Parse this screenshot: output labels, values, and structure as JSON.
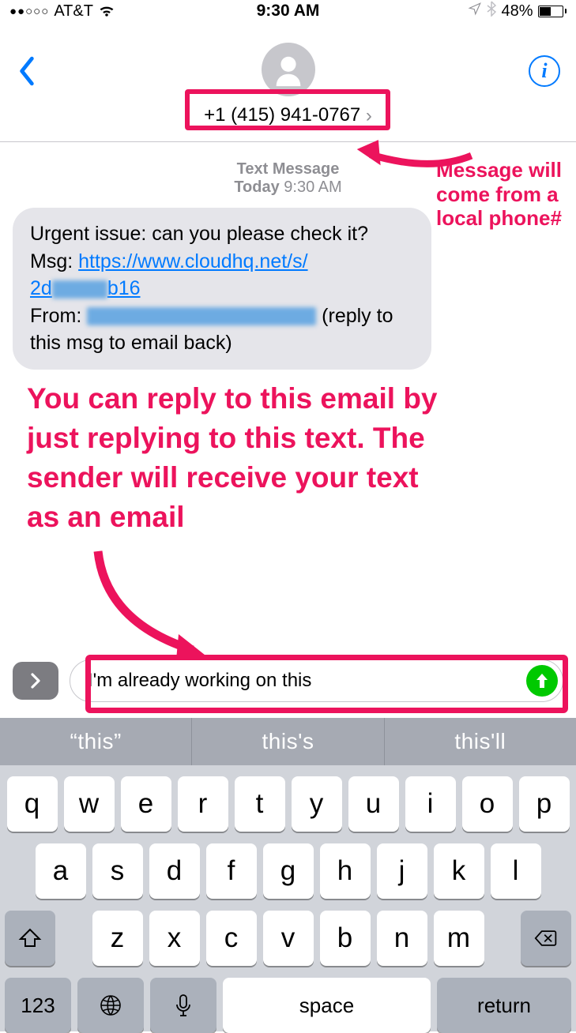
{
  "status": {
    "carrier": "AT&T",
    "time": "9:30 AM",
    "battery_pct": "48%"
  },
  "header": {
    "contact_number": "+1 (415) 941-0767"
  },
  "timestamp": {
    "label": "Text Message",
    "day": "Today",
    "time": "9:30 AM"
  },
  "message": {
    "line1": "Urgent issue: can you please check it?",
    "msg_prefix": "Msg: ",
    "link_part1": "https://www.cloudhq.net/s/",
    "link_part2_prefix": "2d",
    "link_part2_suffix": "b16",
    "from_prefix": "From: ",
    "from_suffix": " (reply to this msg to email back)"
  },
  "annotations": {
    "a1_l1": "Message will",
    "a1_l2": "come from a",
    "a1_l3": "local phone#",
    "a2_l1": "You can reply to this email by",
    "a2_l2": "just replying to this text. The",
    "a2_l3": "sender will receive your text",
    "a2_l4": "as an email"
  },
  "compose": {
    "value": "I'm already working on this"
  },
  "suggestions": {
    "s1": "“this”",
    "s2": "this's",
    "s3": "this'll"
  },
  "keyboard": {
    "row1": [
      "q",
      "w",
      "e",
      "r",
      "t",
      "y",
      "u",
      "i",
      "o",
      "p"
    ],
    "row2": [
      "a",
      "s",
      "d",
      "f",
      "g",
      "h",
      "j",
      "k",
      "l"
    ],
    "row3": [
      "z",
      "x",
      "c",
      "v",
      "b",
      "n",
      "m"
    ],
    "fn_123": "123",
    "fn_space": "space",
    "fn_return": "return"
  }
}
